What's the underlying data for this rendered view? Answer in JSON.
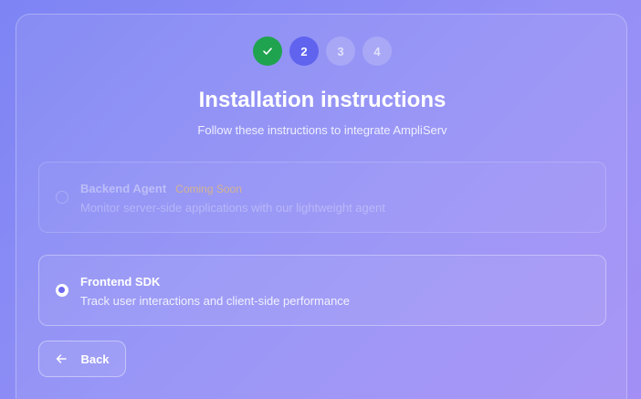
{
  "stepper": {
    "steps": [
      {
        "label": "",
        "state": "done",
        "icon": "check-icon"
      },
      {
        "label": "2",
        "state": "active"
      },
      {
        "label": "3",
        "state": "pending"
      },
      {
        "label": "4",
        "state": "pending"
      }
    ]
  },
  "header": {
    "title": "Installation instructions",
    "subtitle": "Follow these instructions to integrate AmpliServ"
  },
  "options": [
    {
      "title": "Backend Agent",
      "badge": "Coming Soon",
      "description": "Monitor server-side applications with our lightweight agent",
      "selected": false,
      "disabled": true
    },
    {
      "title": "Frontend SDK",
      "description": "Track user interactions and client-side performance",
      "selected": true,
      "disabled": false
    }
  ],
  "actions": {
    "back_label": "Back",
    "back_icon": "arrow-left-icon"
  },
  "colors": {
    "step_done": "#1fa34f",
    "step_active": "#5f63ee",
    "badge": "#e8be6e",
    "radio_dot": "#6d69f0"
  }
}
